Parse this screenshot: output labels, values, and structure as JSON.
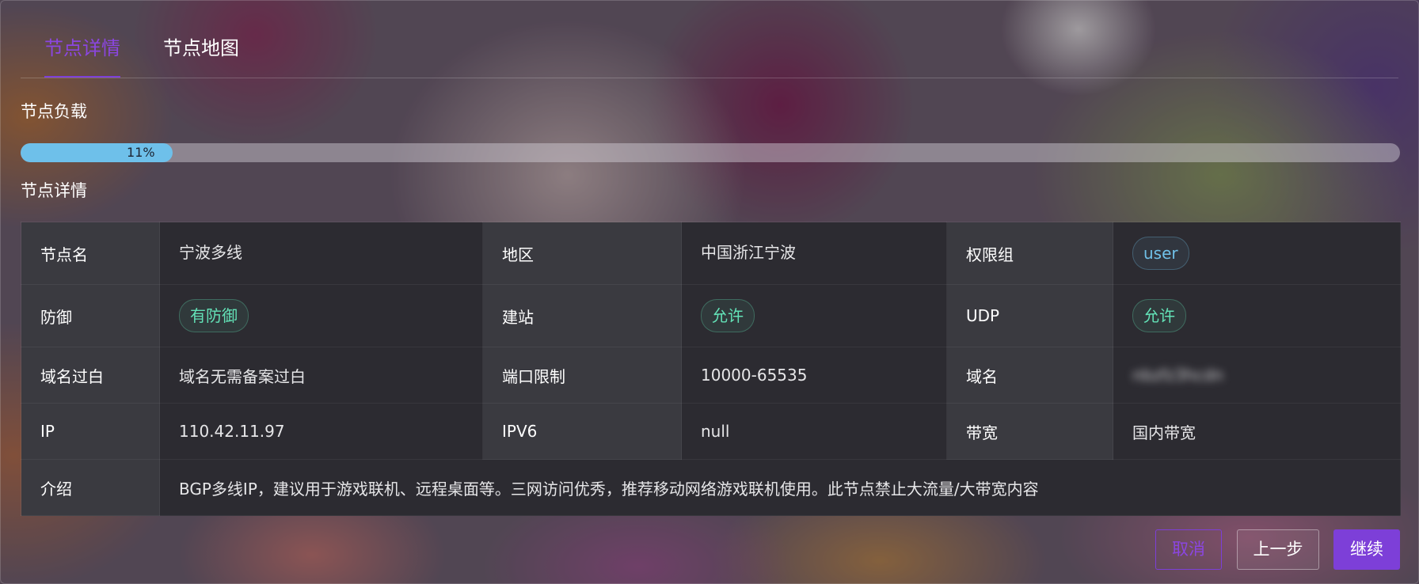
{
  "tabs": [
    {
      "label": "节点详情",
      "active": true
    },
    {
      "label": "节点地图",
      "active": false
    }
  ],
  "load": {
    "title": "节点负载",
    "percent_label": "11%",
    "percent": 0.11
  },
  "details": {
    "title": "节点详情",
    "rows": [
      [
        {
          "key": "节点名",
          "value": "宁波多线"
        },
        {
          "key": "地区",
          "value": "中国浙江宁波"
        },
        {
          "key": "权限组",
          "value": "user",
          "tag": "blue"
        }
      ],
      [
        {
          "key": "防御",
          "value": "有防御",
          "tag": "green"
        },
        {
          "key": "建站",
          "value": "允许",
          "tag": "green"
        },
        {
          "key": "UDP",
          "value": "允许",
          "tag": "green"
        }
      ],
      [
        {
          "key": "域名过白",
          "value": "域名无需备案过白"
        },
        {
          "key": "端口限制",
          "value": "10000-65535"
        },
        {
          "key": "域名",
          "value": "nbzfz3hcdn",
          "blurred": true
        }
      ],
      [
        {
          "key": "IP",
          "value": "110.42.11.97"
        },
        {
          "key": "IPV6",
          "value": "null"
        },
        {
          "key": "带宽",
          "value": "国内带宽"
        }
      ]
    ],
    "intro": {
      "key": "介绍",
      "value": "BGP多线IP，建议用于游戏联机、远程桌面等。三网访问优秀，推荐移动网络游戏联机使用。此节点禁止大流量/大带宽内容"
    }
  },
  "buttons": {
    "cancel": "取消",
    "prev": "上一步",
    "continue": "继续"
  },
  "colors": {
    "accent": "#7d3fd8",
    "progress": "#6ec0ea",
    "tag_green": "#63e2b7",
    "tag_blue": "#70c0e8"
  }
}
